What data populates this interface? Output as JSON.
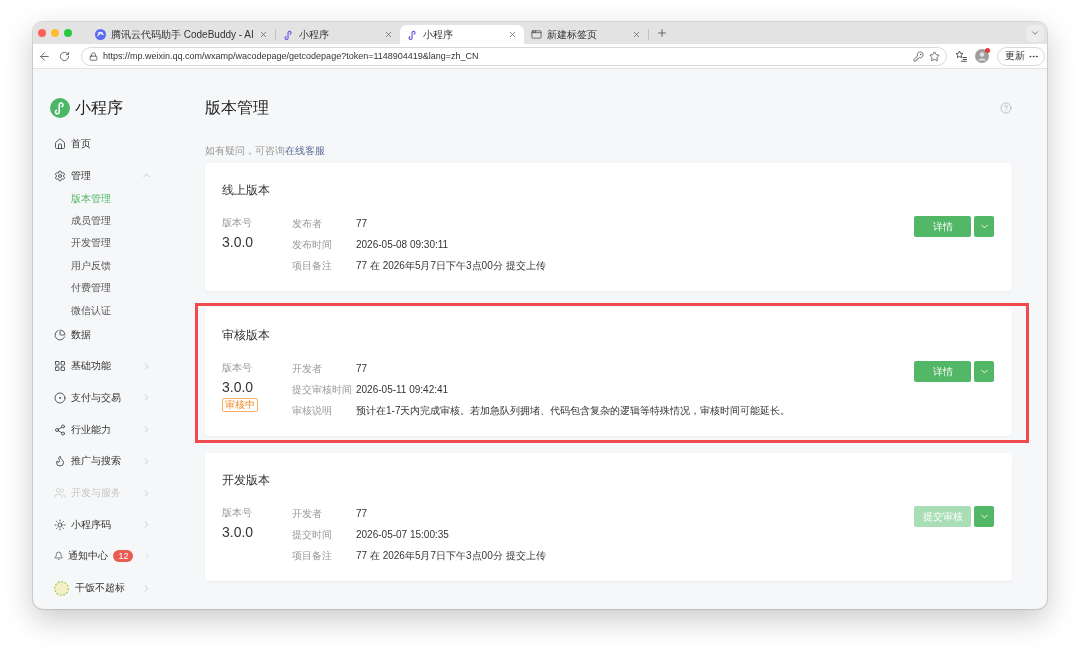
{
  "browser": {
    "tabs": [
      {
        "title": "腾讯云代码助手 CodeBuddy - AI",
        "selected": false
      },
      {
        "title": "小程序",
        "selected": false
      },
      {
        "title": "小程序",
        "selected": true
      },
      {
        "title": "新建标签页",
        "selected": false
      }
    ],
    "url": "https://mp.weixin.qq.com/wxamp/wacodepage/getcodepage?token=1148904419&lang=zh_CN",
    "profile_notification": true,
    "update_button": "更新"
  },
  "sidebar": {
    "app_name": "小程序",
    "items": [
      {
        "label": "首页",
        "kind": "link",
        "selected": false,
        "disabled": false
      },
      {
        "label": "管理",
        "kind": "menu",
        "expanded": true,
        "disabled": false,
        "children": [
          {
            "label": "版本管理",
            "selected": true
          },
          {
            "label": "成员管理",
            "selected": false
          },
          {
            "label": "开发管理",
            "selected": false
          },
          {
            "label": "用户反馈",
            "selected": false
          },
          {
            "label": "付费管理",
            "selected": false
          },
          {
            "label": "微信认证",
            "selected": false
          }
        ]
      },
      {
        "label": "数据",
        "kind": "link",
        "selected": false,
        "disabled": false
      },
      {
        "label": "基础功能",
        "kind": "menu",
        "expanded": false,
        "disabled": false
      },
      {
        "label": "支付与交易",
        "kind": "menu",
        "expanded": false,
        "disabled": false
      },
      {
        "label": "行业能力",
        "kind": "menu",
        "expanded": false,
        "disabled": false
      },
      {
        "label": "推广与搜索",
        "kind": "menu",
        "expanded": false,
        "disabled": false
      },
      {
        "label": "开发与服务",
        "kind": "menu",
        "expanded": false,
        "disabled": true
      },
      {
        "label": "小程序码",
        "kind": "menu",
        "expanded": false,
        "disabled": false
      },
      {
        "label": "通知中心",
        "kind": "menu",
        "expanded": false,
        "disabled": false,
        "badge": "12"
      },
      {
        "label": "干饭不超标",
        "kind": "account",
        "expanded": false,
        "disabled": false
      }
    ]
  },
  "page": {
    "title": "版本管理",
    "help_text": "如有疑问，可咨询",
    "help_link": "在线客服"
  },
  "cards": [
    {
      "title": "线上版本",
      "highlighted": false,
      "version_label": "版本号",
      "version": "3.0.0",
      "fields": [
        {
          "label": "发布者",
          "value": "77"
        },
        {
          "label": "发布时间",
          "value": "2026-05-08 09:30:11"
        },
        {
          "label": "项目备注",
          "value": "77 在 2026年5月7日下午3点00分 提交上传"
        }
      ],
      "primary_button": {
        "label": "详情",
        "disabled": false
      }
    },
    {
      "title": "审核版本",
      "highlighted": true,
      "version_label": "版本号",
      "version": "3.0.0",
      "status_badge": "审核中",
      "fields": [
        {
          "label": "开发者",
          "value": "77"
        },
        {
          "label": "提交审核时间",
          "value": "2026-05-11 09:42:41"
        },
        {
          "label": "审核说明",
          "value": "预计在1-7天内完成审核。若加急队列拥堵、代码包含复杂的逻辑等特殊情况，审核时间可能延长。"
        }
      ],
      "primary_button": {
        "label": "详情",
        "disabled": false
      }
    },
    {
      "title": "开发版本",
      "highlighted": false,
      "version_label": "版本号",
      "version": "3.0.0",
      "fields": [
        {
          "label": "开发者",
          "value": "77"
        },
        {
          "label": "提交时间",
          "value": "2026-05-07 15:00:35"
        },
        {
          "label": "项目备注",
          "value": "77 在 2026年5月7日下午3点00分 提交上传"
        }
      ],
      "primary_button": {
        "label": "提交审核",
        "disabled": true
      }
    }
  ]
}
